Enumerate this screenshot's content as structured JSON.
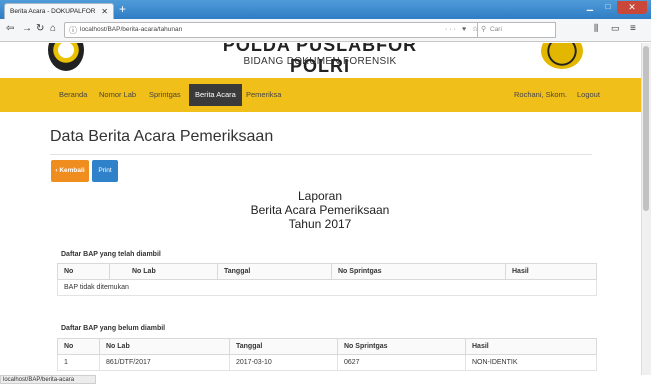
{
  "browser": {
    "tab_title": "Berita Acara - DOKUPALFOR",
    "url": "localhost/BAP/berita-acara/tahunan",
    "search_placeholder": "Cari",
    "status_url": "localhost/BAP/berita-acara"
  },
  "header": {
    "title": "POLDA PUSLABFOR POLRI",
    "subtitle": "BIDANG DOKUMEN FORENSIK"
  },
  "menu": {
    "items": [
      "Beranda",
      "Nomor Lab",
      "Sprintgas",
      "Berita Acara",
      "Pemeriksa"
    ],
    "active": "Berita Acara",
    "user": "Rochani, Skom.",
    "logout": "Logout"
  },
  "page": {
    "title": "Data Berita Acara Pemeriksaan",
    "back_label": "Kembali",
    "print_label": "Print"
  },
  "report": {
    "line1": "Laporan",
    "line2": "Berita Acara Pemeriksaan",
    "line3": "Tahun 2017"
  },
  "taken": {
    "label": "Daftar BAP yang telah diambil",
    "headers": [
      "No",
      "No Lab",
      "Tanggal",
      "No Sprintgas",
      "Hasil"
    ],
    "empty": "BAP tidak ditemukan"
  },
  "not_taken": {
    "label": "Daftar BAP yang belum diambil",
    "headers": [
      "No",
      "No Lab",
      "Tanggal",
      "No Sprintgas",
      "Hasil"
    ],
    "rows": [
      [
        "1",
        "861/DTF/2017",
        "2017-03-10",
        "0627",
        "NON-IDENTIK"
      ]
    ]
  },
  "colors": {
    "menubar": "#f1bf1a",
    "active_menu": "#3a3a3a",
    "back_button": "#f08d1f",
    "print_button": "#2f82c9"
  }
}
